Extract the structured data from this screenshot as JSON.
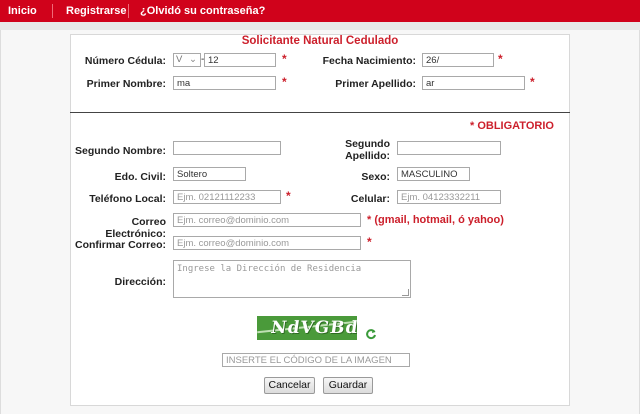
{
  "nav": {
    "items": [
      "Inicio",
      "Registrarse",
      "¿Olvidó su contraseña?"
    ]
  },
  "form": {
    "title": "Solicitante Natural Cedulado",
    "obligatorio": "* OBLIGATORIO",
    "star": "*",
    "cedula": {
      "label": "Número Cédula:",
      "prefix": "V",
      "value": "12"
    },
    "fecha_nacimiento": {
      "label": "Fecha Nacimiento:",
      "value": "26/"
    },
    "primer_nombre": {
      "label": "Primer Nombre:",
      "value": "ma"
    },
    "primer_apellido": {
      "label": "Primer Apellido:",
      "value": "ar"
    },
    "segundo_nombre": {
      "label": "Segundo Nombre:",
      "value": ""
    },
    "segundo_apellido": {
      "label_line1": "Segundo",
      "label_line2": "Apellido:",
      "value": ""
    },
    "edo_civil": {
      "label": "Edo. Civil:",
      "value": "Soltero"
    },
    "sexo": {
      "label": "Sexo:",
      "value": "MASCULINO"
    },
    "telefono_local": {
      "label": "Teléfono Local:",
      "placeholder": "Ejm. 02121112233"
    },
    "celular": {
      "label": "Celular:",
      "placeholder": "Ejm. 04123332211"
    },
    "correo": {
      "label": "Correo Electrónico:",
      "placeholder": "Ejm. correo@dominio.com",
      "note": "* (gmail, hotmail, ó yahoo)"
    },
    "confirmar_correo": {
      "label": "Confirmar Correo:",
      "placeholder": "Ejm. correo@dominio.com"
    },
    "direccion": {
      "label": "Dirección:",
      "placeholder": "Ingrese la Dirección de Residencia"
    },
    "captcha": {
      "text": "NdVGBd",
      "placeholder": "INSERTE EL CÓDIGO DE LA IMAGEN"
    },
    "buttons": {
      "cancel": "Cancelar",
      "save": "Guardar"
    }
  },
  "colors": {
    "brand_red": "#d0021b",
    "required_red": "#cc1f2b",
    "captcha_green": "#4a9a3a"
  },
  "icons": {
    "refresh": "refresh-icon",
    "select_arrow": "chevron-down-icon"
  }
}
